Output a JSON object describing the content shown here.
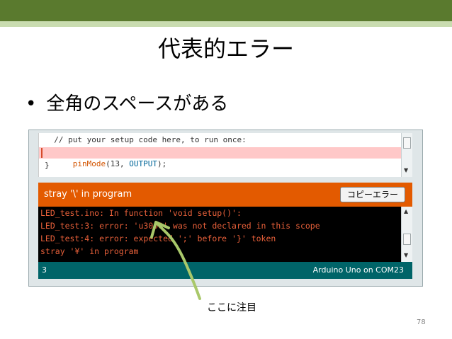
{
  "slide": {
    "title": "代表的エラー",
    "bullet_symbol": "•",
    "bullet": "全角のスペースがある",
    "callout": "ここに注目",
    "page_number": "78"
  },
  "ide": {
    "code_lines": [
      "  // put your setup code here, to run once:",
      "pinMode(13, OUTPUT);",
      "}"
    ],
    "code_highlight": {
      "func": "pinMode",
      "open": "(13, ",
      "const": "OUTPUT",
      "close": ");"
    },
    "status_message": "stray '\\' in program",
    "copy_button_label": "コピーエラー",
    "console_lines": [
      "LED_test.ino: In function 'void setup()':",
      "LED_test:3: error: 'u3000' was not declared in this scope",
      "LED_test:4: error: expected ';' before '}' token",
      "stray '¥' in program"
    ],
    "line_number": "3",
    "board": "Arduino Uno on COM23"
  },
  "colors": {
    "header_band": "#5a7a2e",
    "status_bar": "#e35a00",
    "footer_bar": "#006468",
    "arrow": "#a9c86a"
  }
}
